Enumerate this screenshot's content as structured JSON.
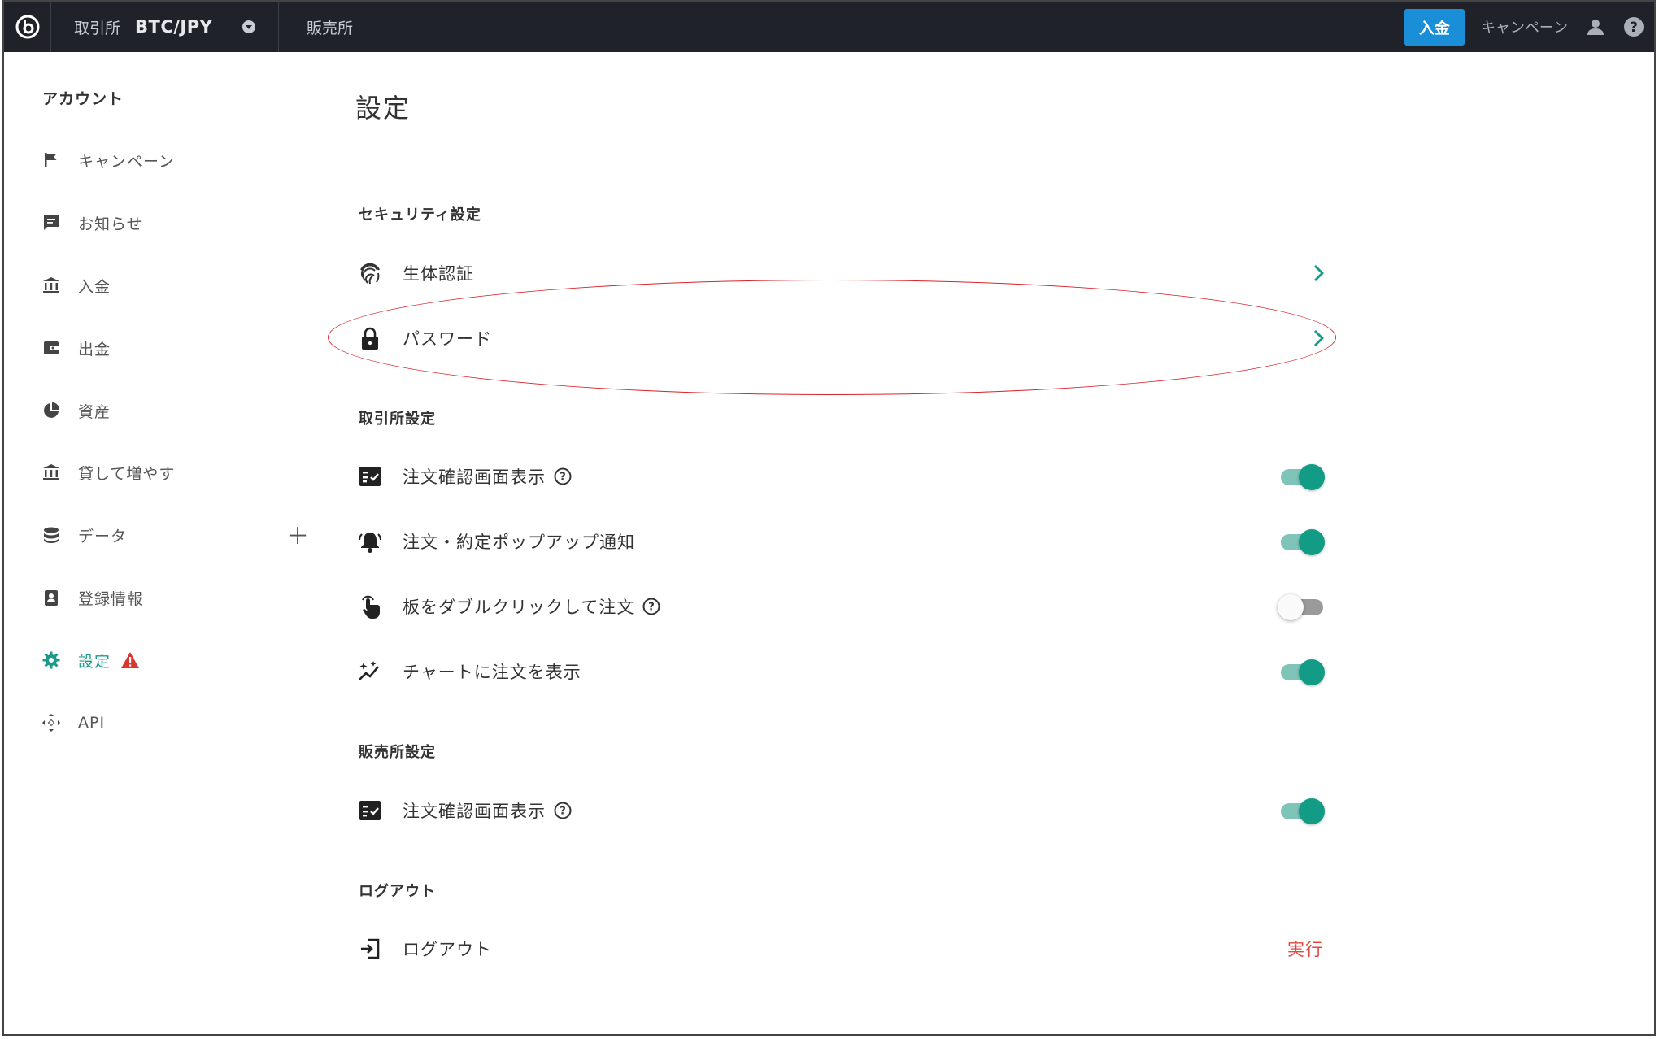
{
  "topbar": {
    "exchange_label": "取引所",
    "pair": "BTC/JPY",
    "hanbaisho": "販売所",
    "deposit_button": "入金",
    "campaign_link": "キャンペーン"
  },
  "sidebar": {
    "title": "アカウント",
    "items": [
      {
        "label": "キャンペーン",
        "icon": "flag-icon"
      },
      {
        "label": "お知らせ",
        "icon": "message-icon"
      },
      {
        "label": "入金",
        "icon": "bank-icon"
      },
      {
        "label": "出金",
        "icon": "wallet-icon"
      },
      {
        "label": "資産",
        "icon": "pie-chart-icon"
      },
      {
        "label": "貸して増やす",
        "icon": "bank-icon"
      },
      {
        "label": "データ",
        "icon": "database-icon",
        "expand": "＋"
      },
      {
        "label": "登録情報",
        "icon": "badge-icon"
      },
      {
        "label": "設定",
        "icon": "gear-icon",
        "active": true,
        "warning": true
      },
      {
        "label": "API",
        "icon": "api-icon"
      }
    ]
  },
  "main": {
    "title": "設定",
    "security": {
      "heading": "セキュリティ設定",
      "biometric": "生体認証",
      "password": "パスワード"
    },
    "exchange": {
      "heading": "取引所設定",
      "rows": [
        {
          "label": "注文確認画面表示",
          "help": true,
          "on": true
        },
        {
          "label": "注文・約定ポップアップ通知",
          "help": false,
          "on": true
        },
        {
          "label": "板をダブルクリックして注文",
          "help": true,
          "on": false
        },
        {
          "label": "チャートに注文を表示",
          "help": false,
          "on": true
        }
      ]
    },
    "hanbai": {
      "heading": "販売所設定",
      "rows": [
        {
          "label": "注文確認画面表示",
          "help": true,
          "on": true
        }
      ]
    },
    "logout": {
      "heading": "ログアウト",
      "label": "ログアウト",
      "action": "実行"
    }
  },
  "colors": {
    "accent": "#129c86",
    "topbar": "#1f2329",
    "deposit": "#1a8fd8",
    "danger": "#e0483e"
  }
}
